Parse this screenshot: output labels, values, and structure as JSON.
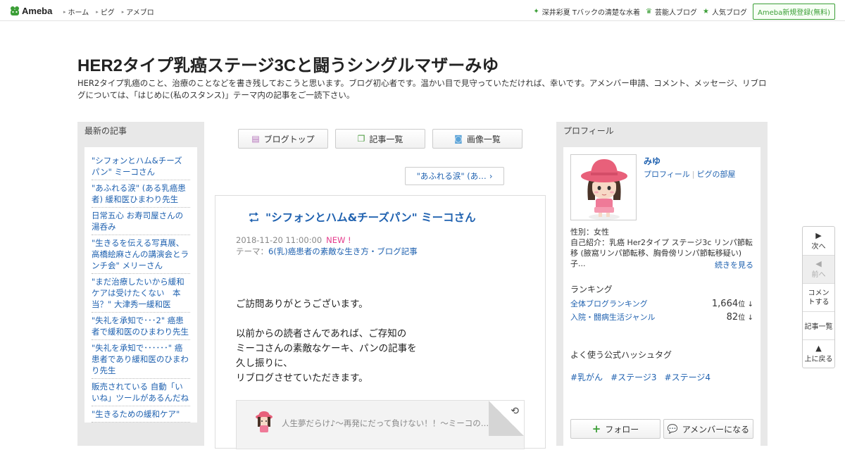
{
  "topbar": {
    "logo_text": "Ameba",
    "nav": [
      "ホーム",
      "ピグ",
      "アメブロ"
    ],
    "right_links": [
      {
        "icon": "sparkle-icon",
        "label": "深井彩夏 Tバックの清楚な水着"
      },
      {
        "icon": "crown-icon",
        "label": "芸能人ブログ"
      },
      {
        "icon": "star-icon",
        "label": "人気ブログ"
      }
    ],
    "signup_label": "Ameba新規登録(無料)"
  },
  "header": {
    "title": "HER2タイプ乳癌ステージ3Cと闘うシングルマザーみゆ",
    "description": "HER2タイプ乳癌のこと、治療のことなどを書き残しておこうと思います。ブログ初心者です。温かい目で見守っていただければ、幸いです。アメンバー申請、コメント、メッセージ、リブログについては、「はじめに(私のスタンス)」テーマ内の記事をご一読下さい。"
  },
  "left": {
    "heading": "最新の記事",
    "items": [
      "\"シフォンとハム&チーズパン\" ミーコさん",
      "\"あふれる涙\" (ある乳癌患者) 緩和医ひまわり先生",
      "日常五心 お寿司屋さんの湯呑み",
      "\"生きるを伝える写真展、高橋絵麻さんの講演会とランチ会\" メリーさん",
      "\"まだ治療したいから緩和ケアは受けたくない　本当？\" 大津秀一緩和医",
      "\"失礼を承知で･･･2\" 癌患者で緩和医のひまわり先生",
      "\"失礼を承知で･･････\" 癌患者であり緩和医のひまわり先生",
      "販売されている 自動「いいね」ツールがあるんだね",
      "\"生きるための緩和ケア\""
    ]
  },
  "center": {
    "buttons": [
      {
        "icon": "document-icon",
        "label": "ブログトップ"
      },
      {
        "icon": "copy-icon",
        "label": "記事一覧"
      },
      {
        "icon": "camera-icon",
        "label": "画像一覧"
      }
    ],
    "prev_link": "\"あふれる涙\" (あ…",
    "entry": {
      "title": "\"シフォンとハム&チーズパン\" ミーコさん",
      "date": "2018-11-20 11:00:00",
      "new_badge": "NEW !",
      "theme_label": "テーマ：",
      "theme": "6(乳)癌患者の素敵な生き方・ブログ記事",
      "paragraphs": [
        [
          "ご訪問ありがとうございます。"
        ],
        [
          "以前からの読者さんであれば、ご存知の",
          "ミーコさんの素敵なケーキ、パンの記事を",
          "久し振りに、",
          "リブログさせていただきます。"
        ]
      ],
      "quote_text": "人生夢だらけ♪〜再発にだって負けない！！〜ミーコの…"
    }
  },
  "right": {
    "heading": "プロフィール",
    "name": "みゆ",
    "profile_link": "プロフィール",
    "pig_link": "ピグの部屋",
    "gender": "性別：女性",
    "intro": "自己紹介：乳癌 Her2タイプ ステージ3c リンパ節転移 (腋窩リンパ節転移、胸骨傍リンパ節転移疑い) 子...",
    "more_label": "続きを見る",
    "ranking_heading": "ランキング",
    "rankings": [
      {
        "label": "全体ブログランキング",
        "value": "1,664",
        "unit": "位",
        "trend": "↓"
      },
      {
        "label": "入院・闘病生活ジャンル",
        "value": "82",
        "unit": "位",
        "trend": "↓"
      }
    ],
    "hashtag_heading": "よく使う公式ハッシュタグ",
    "hashtags": [
      "#乳がん",
      "#ステージ3",
      "#ステージ4"
    ],
    "follow_label": "フォロー",
    "amember_label": "アメンバーになる"
  },
  "floatnav": {
    "next": "次へ",
    "prev": "前へ",
    "comment": "コメントする",
    "list": "記事一覧",
    "top": "上に戻る"
  },
  "colors": {
    "accent": "#3b9e36",
    "link": "#2062b0",
    "new": "#e43a8b"
  }
}
